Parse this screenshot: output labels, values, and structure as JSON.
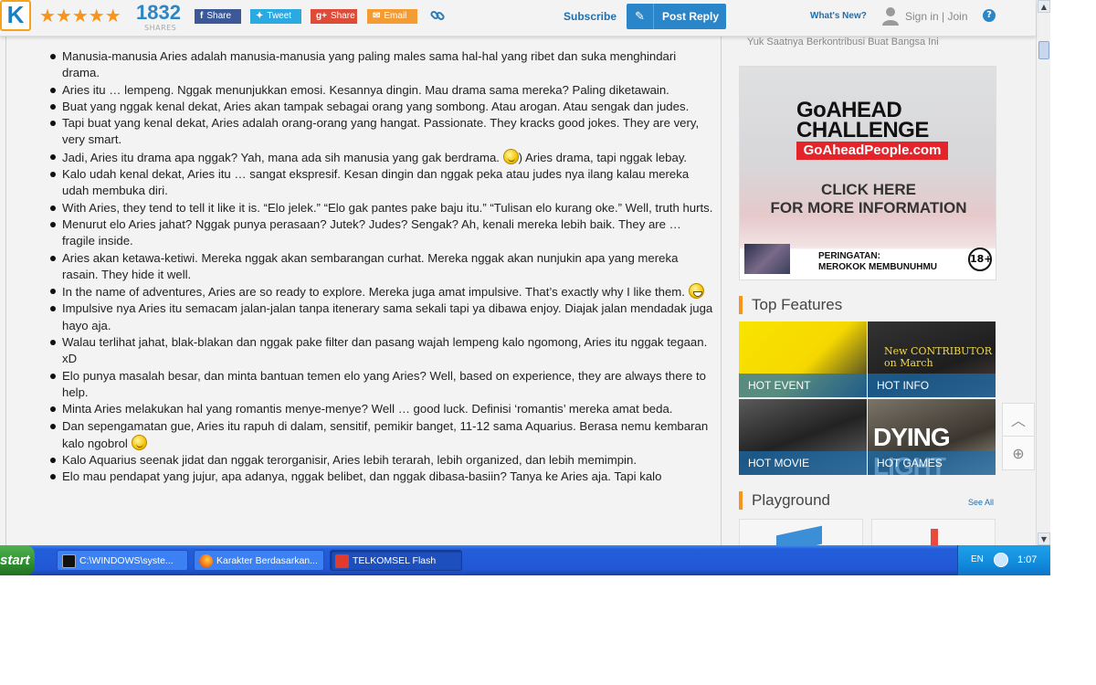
{
  "header": {
    "logo_text": "K",
    "stars": "★★★★★",
    "share_count": "1832",
    "share_caption": "SHARES",
    "facebook_label": "Share",
    "twitter_label": "Tweet",
    "gplus_label": "Share",
    "email_label": "Email",
    "subscribe_label": "Subscribe",
    "post_reply_label": "Post Reply",
    "whats_new_label": "What's New?",
    "signin_label": "Sign in | Join",
    "help_label": "?"
  },
  "post": {
    "items": [
      "Manusia-manusia Aries adalah manusia-manusia yang paling males sama hal-hal yang ribet dan suka menghindari drama.",
      "Aries itu … lempeng. Nggak menunjukkan emosi. Kesannya dingin. Mau drama sama mereka? Paling diketawain.",
      "Buat yang nggak kenal dekat, Aries akan tampak sebagai orang yang sombong. Atau arogan. Atau sengak dan judes.",
      "Tapi buat yang kenal dekat, Aries adalah orang-orang yang hangat. Passionate. They kracks good jokes. They are very, very smart.",
      "Jadi, Aries itu drama apa nggak? Yah, mana ada sih manusia yang gak berdrama.",
      "Kalo udah kenal dekat, Aries itu … sangat ekspresif. Kesan dingin dan nggak peka atau judes nya ilang kalau mereka udah membuka diri.",
      "With Aries, they tend to tell it like it is. “Elo jelek.” “Elo gak pantes pake baju itu.” “Tulisan elo kurang oke.” Well, truth hurts.",
      "Menurut elo Aries jahat? Nggak punya perasaan? Jutek? Judes? Sengak? Ah, kenali mereka lebih baik. They are … fragile inside.",
      "Aries akan ketawa-ketiwi. Mereka nggak akan sembarangan curhat. Mereka nggak akan nunjukin apa yang mereka rasain. They hide it well.",
      "In the name of adventures, Aries are so ready to explore. Mereka juga amat impulsive. That’s exactly why I like them.",
      "Impulsive nya Aries itu semacam jalan-jalan tanpa itenerary sama sekali tapi ya dibawa enjoy. Diajak jalan mendadak juga hayo aja.",
      "Walau terlihat jahat, blak-blakan dan nggak pake filter dan pasang wajah lempeng kalo ngomong, Aries itu nggak tegaan. xD",
      "Elo punya masalah besar, dan minta bantuan temen elo yang Aries? Well, based on experience, they are always there to help.",
      "Minta Aries melakukan hal yang romantis menye-menye? Well … good luck. Definisi ‘romantis’ mereka amat beda.",
      "Dan sepengamatan gue, Aries itu rapuh di dalam, sensitif, pemikir banget, 11-12 sama Aquarius. Berasa nemu kembaran kalo ngobrol",
      "Kalo Aquarius seenak jidat dan nggak terorganisir, Aries lebih terarah, lebih organized, dan lebih memimpin.",
      "Elo mau pendapat yang jujur, apa adanya, nggak belibet, dan nggak dibasa-basiin? Tanya ke Aries aja. Tapi kalo"
    ],
    "item5_suffix": ") Aries drama, tapi nggak lebay."
  },
  "sidebar": {
    "tagline": "Yuk Saatnya Berkontribusi Buat Bangsa Ini",
    "ad": {
      "line1": "GoAHEAD",
      "line2": "CHALLENGE",
      "site": "GoAheadPeople.com",
      "cta1": "CLICK HERE",
      "cta2": "FOR MORE INFORMATION",
      "warn1": "PERINGATAN:",
      "warn2": "MEROKOK MEMBUNUHMU",
      "age": "18+"
    },
    "top_features_title": "Top Features",
    "features": [
      {
        "label": "HOT EVENT"
      },
      {
        "label": "HOT INFO"
      },
      {
        "label": "HOT MOVIE"
      },
      {
        "label": "HOT GAMES"
      }
    ],
    "info_tile_text": "New CONTRIBUTOR on March",
    "games_tile_text": "DYING LIGHT",
    "playground_title": "Playground",
    "see_all_label": "See All"
  },
  "taskbar": {
    "start_label": "start",
    "tasks": [
      {
        "label": "C:\\WINDOWS\\syste..."
      },
      {
        "label": "Karakter Berdasarkan..."
      },
      {
        "label": "TELKOMSEL Flash"
      }
    ],
    "lang": "EN",
    "clock": "1:07"
  },
  "colors": {
    "accent_blue": "#2a86c8",
    "accent_orange": "#f7941d",
    "taskbar_blue": "#245edb"
  }
}
